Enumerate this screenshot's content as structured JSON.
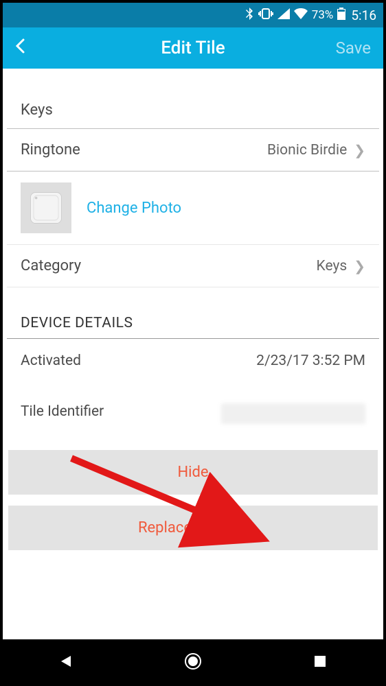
{
  "status": {
    "battery": "73%",
    "time": "5:16"
  },
  "header": {
    "title": "Edit Tile",
    "save": "Save"
  },
  "name_row": {
    "label": "Keys"
  },
  "ringtone": {
    "label": "Ringtone",
    "value": "Bionic Birdie"
  },
  "photo": {
    "change_label": "Change Photo"
  },
  "category": {
    "label": "Category",
    "value": "Keys"
  },
  "details": {
    "section": "DEVICE DETAILS",
    "activated_label": "Activated",
    "activated_value": "2/23/17 3:52 PM",
    "identifier_label": "Tile Identifier"
  },
  "actions": {
    "hide": "Hide",
    "replace": "Replace this Tile"
  }
}
